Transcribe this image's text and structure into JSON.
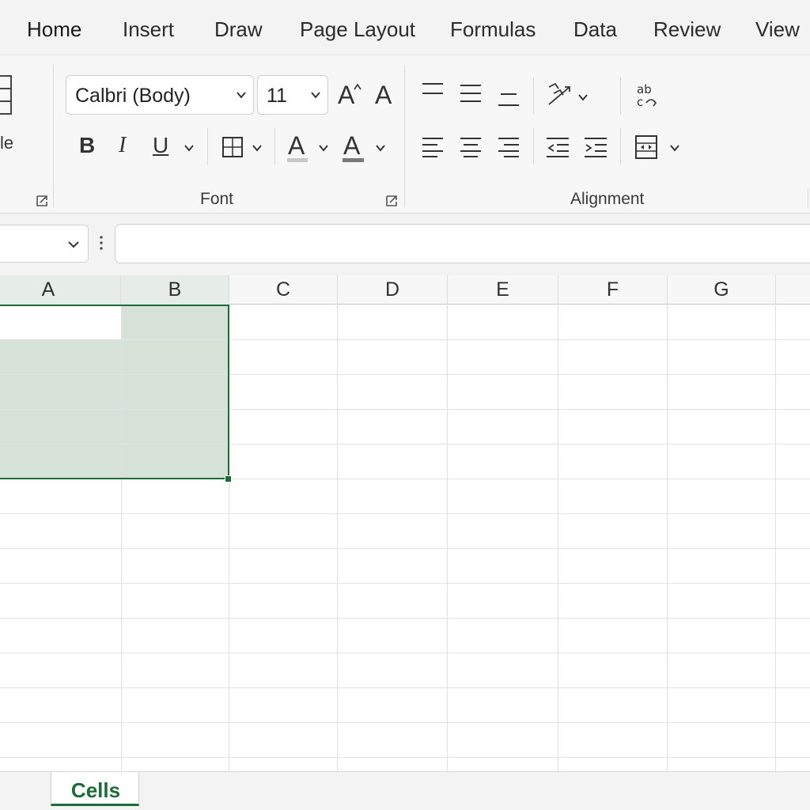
{
  "tabs": [
    "Home",
    "Insert",
    "Draw",
    "Page Layout",
    "Formulas",
    "Data",
    "Review",
    "View"
  ],
  "ribbon": {
    "left_partial_label": "le",
    "font_name": "Calbri (Body)",
    "font_size": "11",
    "groups": {
      "font": "Font",
      "alignment": "Alignment"
    },
    "glyphs": {
      "grow": "A",
      "shrink": "A",
      "bold": "B",
      "italic": "I",
      "underline": "U",
      "highlight": "A",
      "font_color": "A"
    },
    "icons": {
      "fill_color_bar": "#c8c8c8",
      "font_color_bar": "#7a7a7a"
    }
  },
  "columns": [
    "A",
    "B",
    "C",
    "D",
    "E",
    "F",
    "G"
  ],
  "sheet": {
    "active_tab": "Cells"
  },
  "colors": {
    "accent": "#1d6b38",
    "selection": "#d6e1d8"
  }
}
